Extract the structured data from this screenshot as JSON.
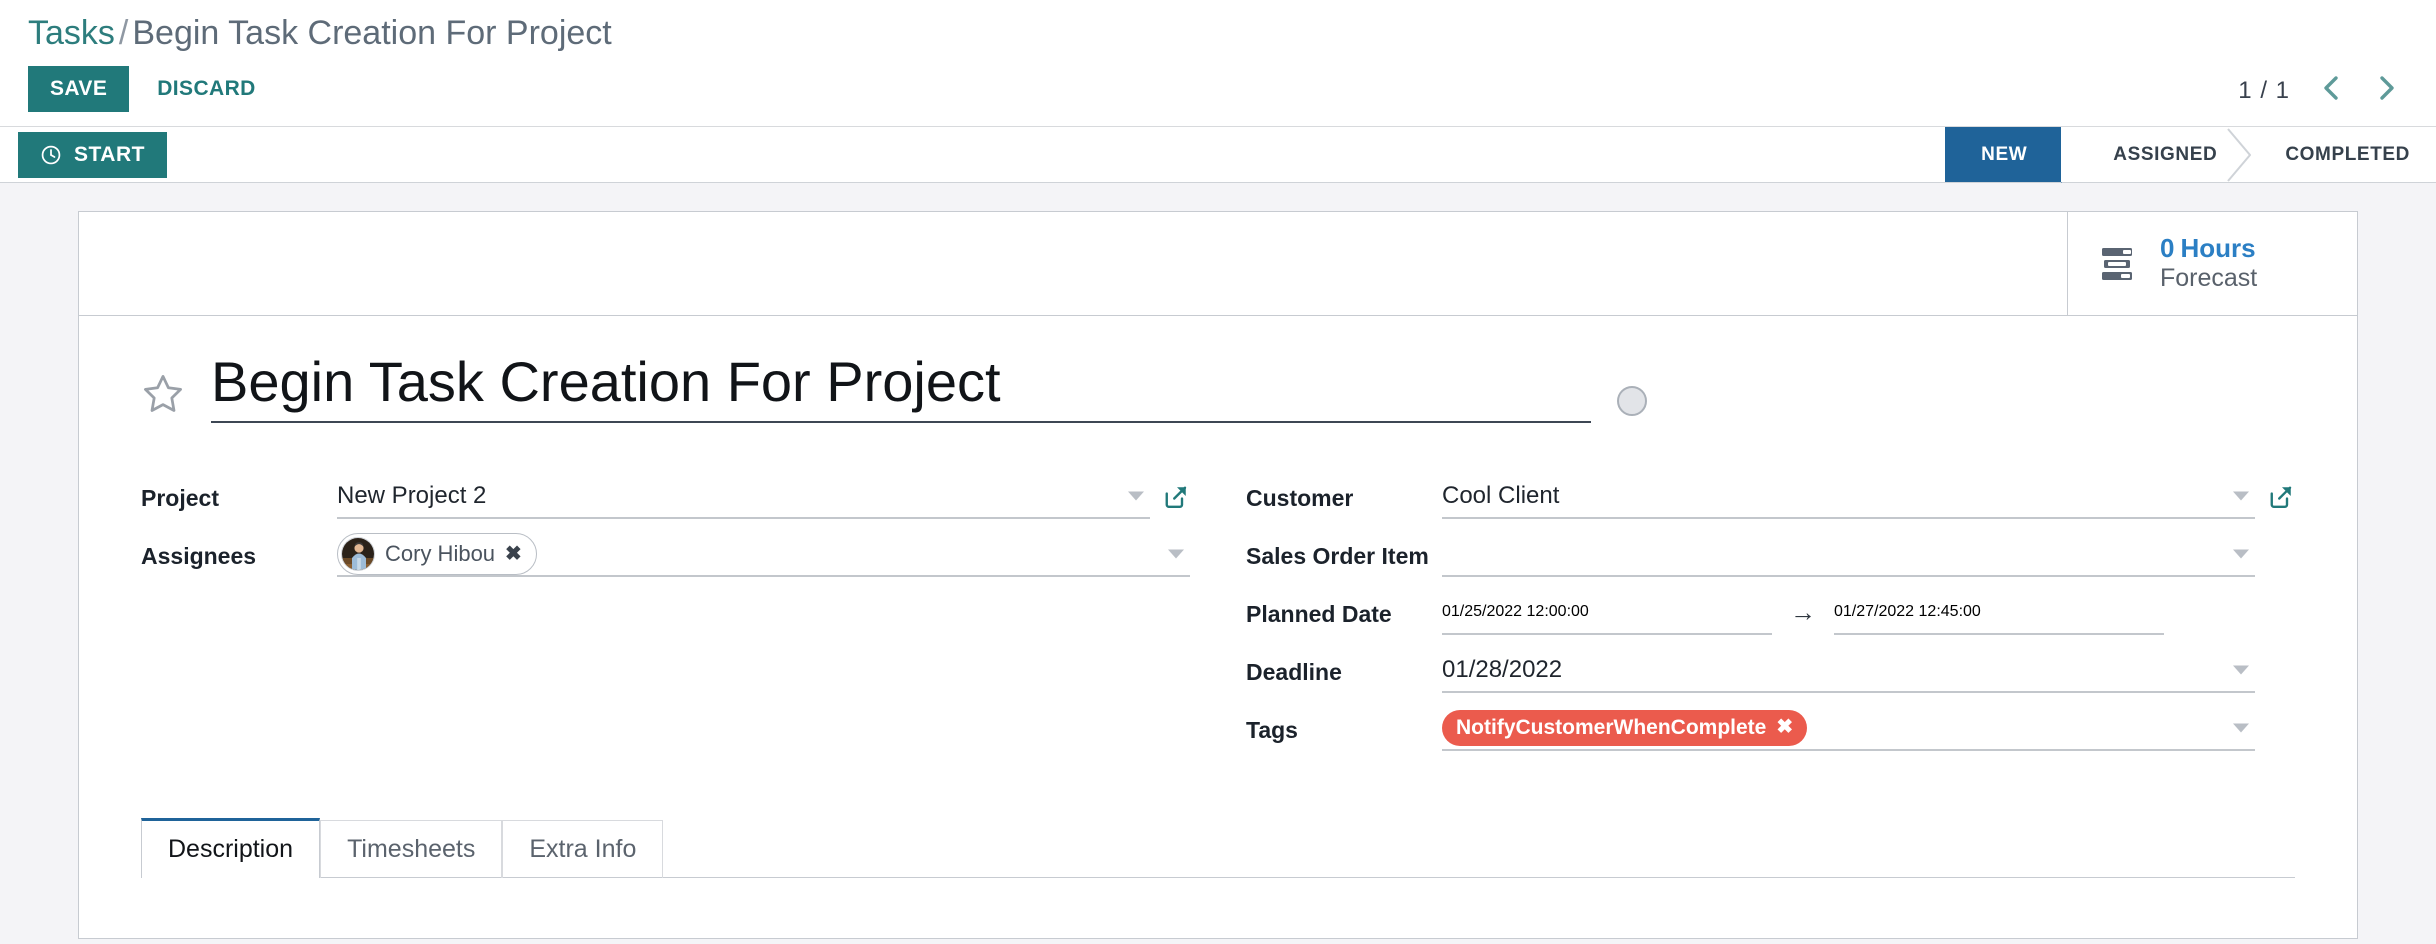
{
  "breadcrumb": {
    "root": "Tasks",
    "separator": "/",
    "current": "Begin Task Creation For Project"
  },
  "toolbar": {
    "save_label": "SAVE",
    "discard_label": "DISCARD"
  },
  "pager": {
    "value": "1 / 1",
    "prev_icon": "chevron-left-icon",
    "next_icon": "chevron-right-icon"
  },
  "timer": {
    "start_label": "START",
    "icon": "clock-icon"
  },
  "statusbar": {
    "stages": [
      {
        "label": "NEW",
        "active": true
      },
      {
        "label": "ASSIGNED",
        "active": false
      },
      {
        "label": "COMPLETED",
        "active": false
      }
    ],
    "active_color": "#1f6399"
  },
  "button_box": {
    "forecast": {
      "icon": "gantt-bars-icon",
      "value": "0",
      "unit": "Hours",
      "label": "Forecast",
      "value_color": "#2b7fc4"
    }
  },
  "record": {
    "priority_icon": "star-outline-icon",
    "title": "Begin Task Creation For Project",
    "kanban_state_icon": "kanban-state-circle"
  },
  "form": {
    "left": [
      {
        "label": "Project",
        "value": "New Project 2",
        "type": "many2one",
        "has_external_link": true
      },
      {
        "label": "Assignees",
        "type": "many2many_tags_avatar",
        "tags": [
          {
            "name": "Cory Hibou",
            "remove_icon": "remove-tag-icon"
          }
        ]
      }
    ],
    "right": [
      {
        "label": "Customer",
        "value": "Cool Client",
        "type": "many2one",
        "has_external_link": true
      },
      {
        "label": "Sales Order Item",
        "value": "",
        "type": "many2one",
        "has_external_link": false
      },
      {
        "label": "Planned Date",
        "type": "daterange",
        "start": "01/25/2022 12:00:00",
        "arrow": "→",
        "end": "01/27/2022 12:45:00"
      },
      {
        "label": "Deadline",
        "value": "01/28/2022",
        "type": "date"
      },
      {
        "label": "Tags",
        "type": "many2many_tags",
        "tags": [
          {
            "name": "NotifyCustomerWhenComplete",
            "color": "#eb5b4d",
            "remove_icon": "remove-tag-icon"
          }
        ]
      }
    ]
  },
  "notebook": {
    "tabs": [
      {
        "label": "Description",
        "active": true
      },
      {
        "label": "Timesheets",
        "active": false
      },
      {
        "label": "Extra Info",
        "active": false
      }
    ]
  },
  "theme": {
    "primary": "#21797a",
    "status_active": "#1f6399",
    "link_blue": "#2b7fc4",
    "tag_red": "#eb5b4d"
  }
}
